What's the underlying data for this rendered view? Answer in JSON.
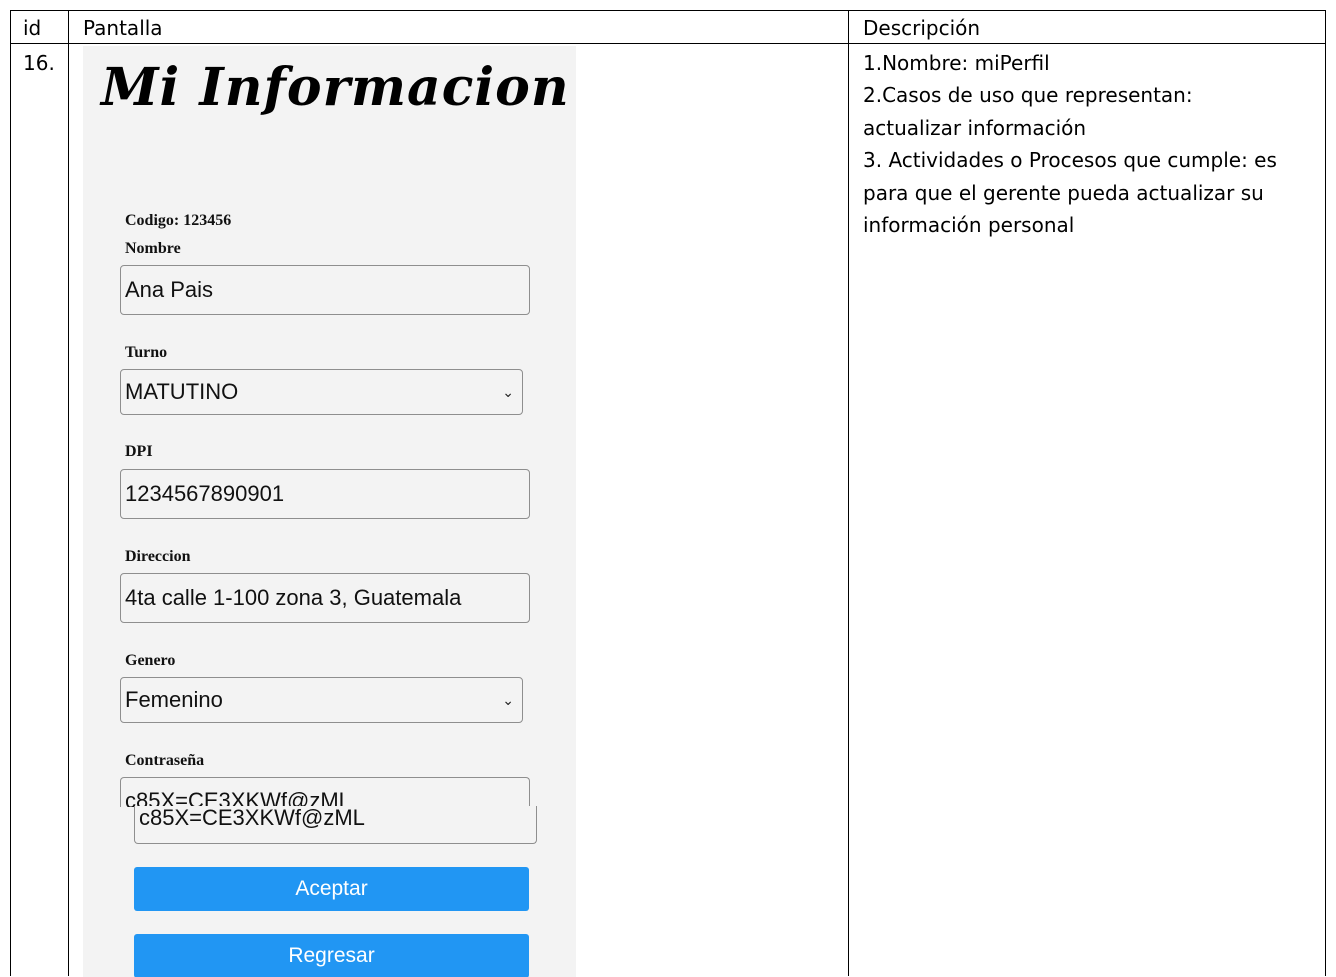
{
  "table": {
    "headers": {
      "id": "id",
      "pantalla": "Pantalla",
      "descripcion": "Descripción"
    },
    "row": {
      "id": "16.",
      "descripcion_lines": [
        "1.Nombre: miPerfil",
        "2.Casos de uso que representan:",
        "actualizar información",
        "3. Actividades o Procesos que cumple: es",
        "para que el gerente pueda actualizar su",
        "información personal"
      ]
    }
  },
  "screen": {
    "title": "Mi Informacion",
    "codigo": "Codigo: 123456",
    "nombre": {
      "label": "Nombre",
      "value": "Ana Pais"
    },
    "turno": {
      "label": "Turno",
      "value": "MATUTINO"
    },
    "dpi": {
      "label": "DPI",
      "value": "1234567890901"
    },
    "direccion": {
      "label": "Direccion",
      "value": "4ta calle 1-100 zona 3, Guatemala"
    },
    "genero": {
      "label": "Genero",
      "value": "Femenino"
    },
    "contrasena": {
      "label": "Contraseña",
      "value": "c85X=CE3XKWf@zML"
    },
    "buttons": {
      "aceptar": "Aceptar",
      "regresar": "Regresar"
    }
  }
}
